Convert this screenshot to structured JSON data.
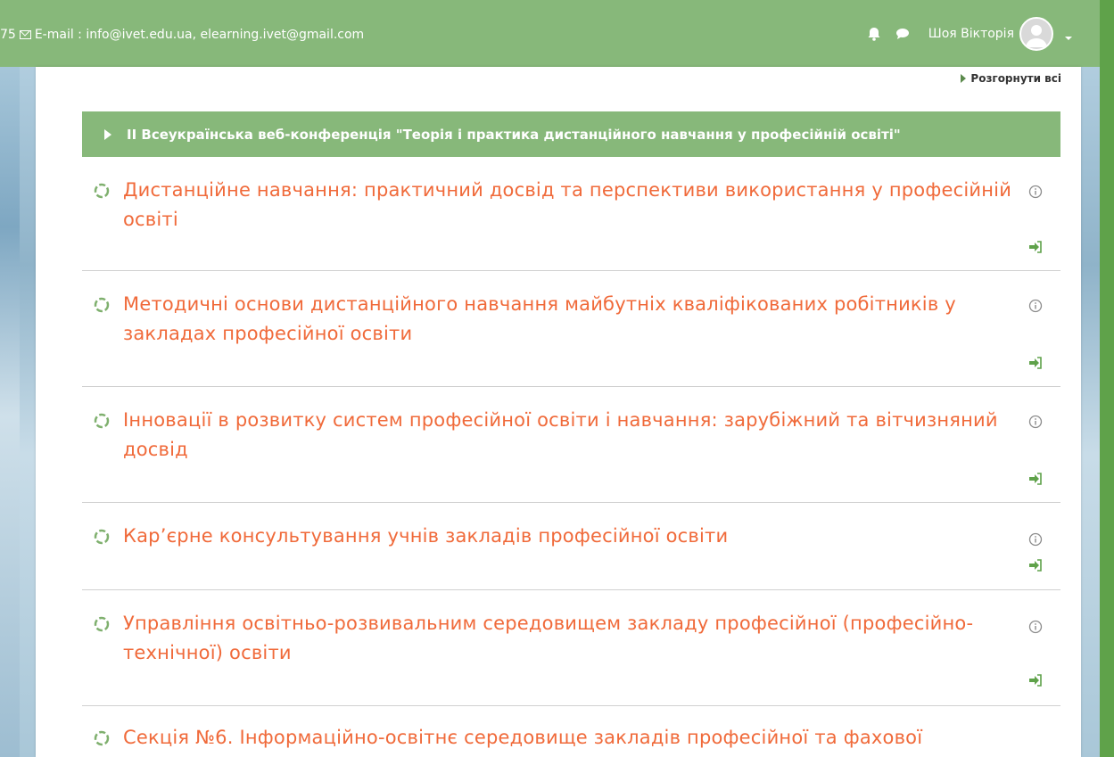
{
  "topbar": {
    "contact_prefix": "75",
    "email_label": "E-mail : info@ivet.edu.ua, elearning.ivet@gmail.com",
    "user_name": "Шоя Вікторія",
    "icons": [
      "bell-icon",
      "chat-icon",
      "avatar",
      "caret-down-icon"
    ]
  },
  "content": {
    "expand_all": "Розгорнути всі",
    "section_title": "ІІ Всеукраїнська веб-конференція \"Теорія і практика дистанційного навчання у професійній освіті\"",
    "courses": [
      {
        "title": "Дистанційне навчання: практичний досвід та перспективи використання у професійній освіті"
      },
      {
        "title": "Методичні основи дистанційного навчання майбутніх кваліфікованих робітників у закладах професійної освіти"
      },
      {
        "title": "Інновації в розвитку систем професійної освіти і навчання: зарубіжний та вітчизняний досвід"
      },
      {
        "title": "Кар’єрне консультування учнів закладів професійної освіти"
      },
      {
        "title": "Управління освітньо-розвивальним середовищем закладу професійної (професійно-технічної) освіти"
      },
      {
        "title": "Секція №6. Інформаційно-освітнє середовище закладів професійної та фахової"
      }
    ]
  },
  "colors": {
    "header_green": "#87b87a",
    "course_link": "#f06a3a",
    "icon_green": "#5fa24a",
    "icon_gray": "#8c8c8c"
  }
}
